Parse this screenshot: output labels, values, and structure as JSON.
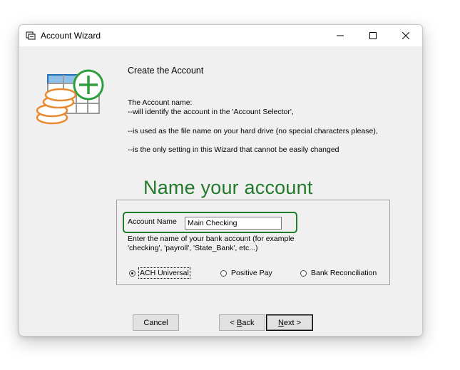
{
  "window": {
    "title": "Account Wizard",
    "app_icon": "account-wizard-icon",
    "controls": [
      "minimize-icon",
      "maximize-icon",
      "close-icon"
    ]
  },
  "header": {
    "heading": "Create the Account",
    "description": [
      "The Account name:",
      "--will identify the account in the 'Account Selector',",
      "--is used as the file name on your hard drive (no special characters please),",
      "--is the only setting in this Wizard that cannot be easily changed"
    ]
  },
  "callout": "Name your account",
  "form": {
    "account_name_label": "Account Name",
    "account_name_value": "Main Checking",
    "hint_line1": "Enter the name of your bank account (for example",
    "hint_line2": "'checking', 'payroll', 'State_Bank', etc...)",
    "radios": [
      {
        "label": "ACH Universal",
        "checked": true
      },
      {
        "label": "Positive Pay",
        "checked": false
      },
      {
        "label": "Bank Reconciliation",
        "checked": false
      }
    ]
  },
  "buttons": {
    "cancel": "Cancel",
    "back_prefix": "< ",
    "back_key": "B",
    "back_rest": "ack",
    "next_key": "N",
    "next_rest": "ext >"
  },
  "colors": {
    "callout_green": "#237a2d",
    "logo_blue": "#1f6fb2",
    "logo_orange": "#e98a2e",
    "logo_green": "#2e9e3e"
  }
}
